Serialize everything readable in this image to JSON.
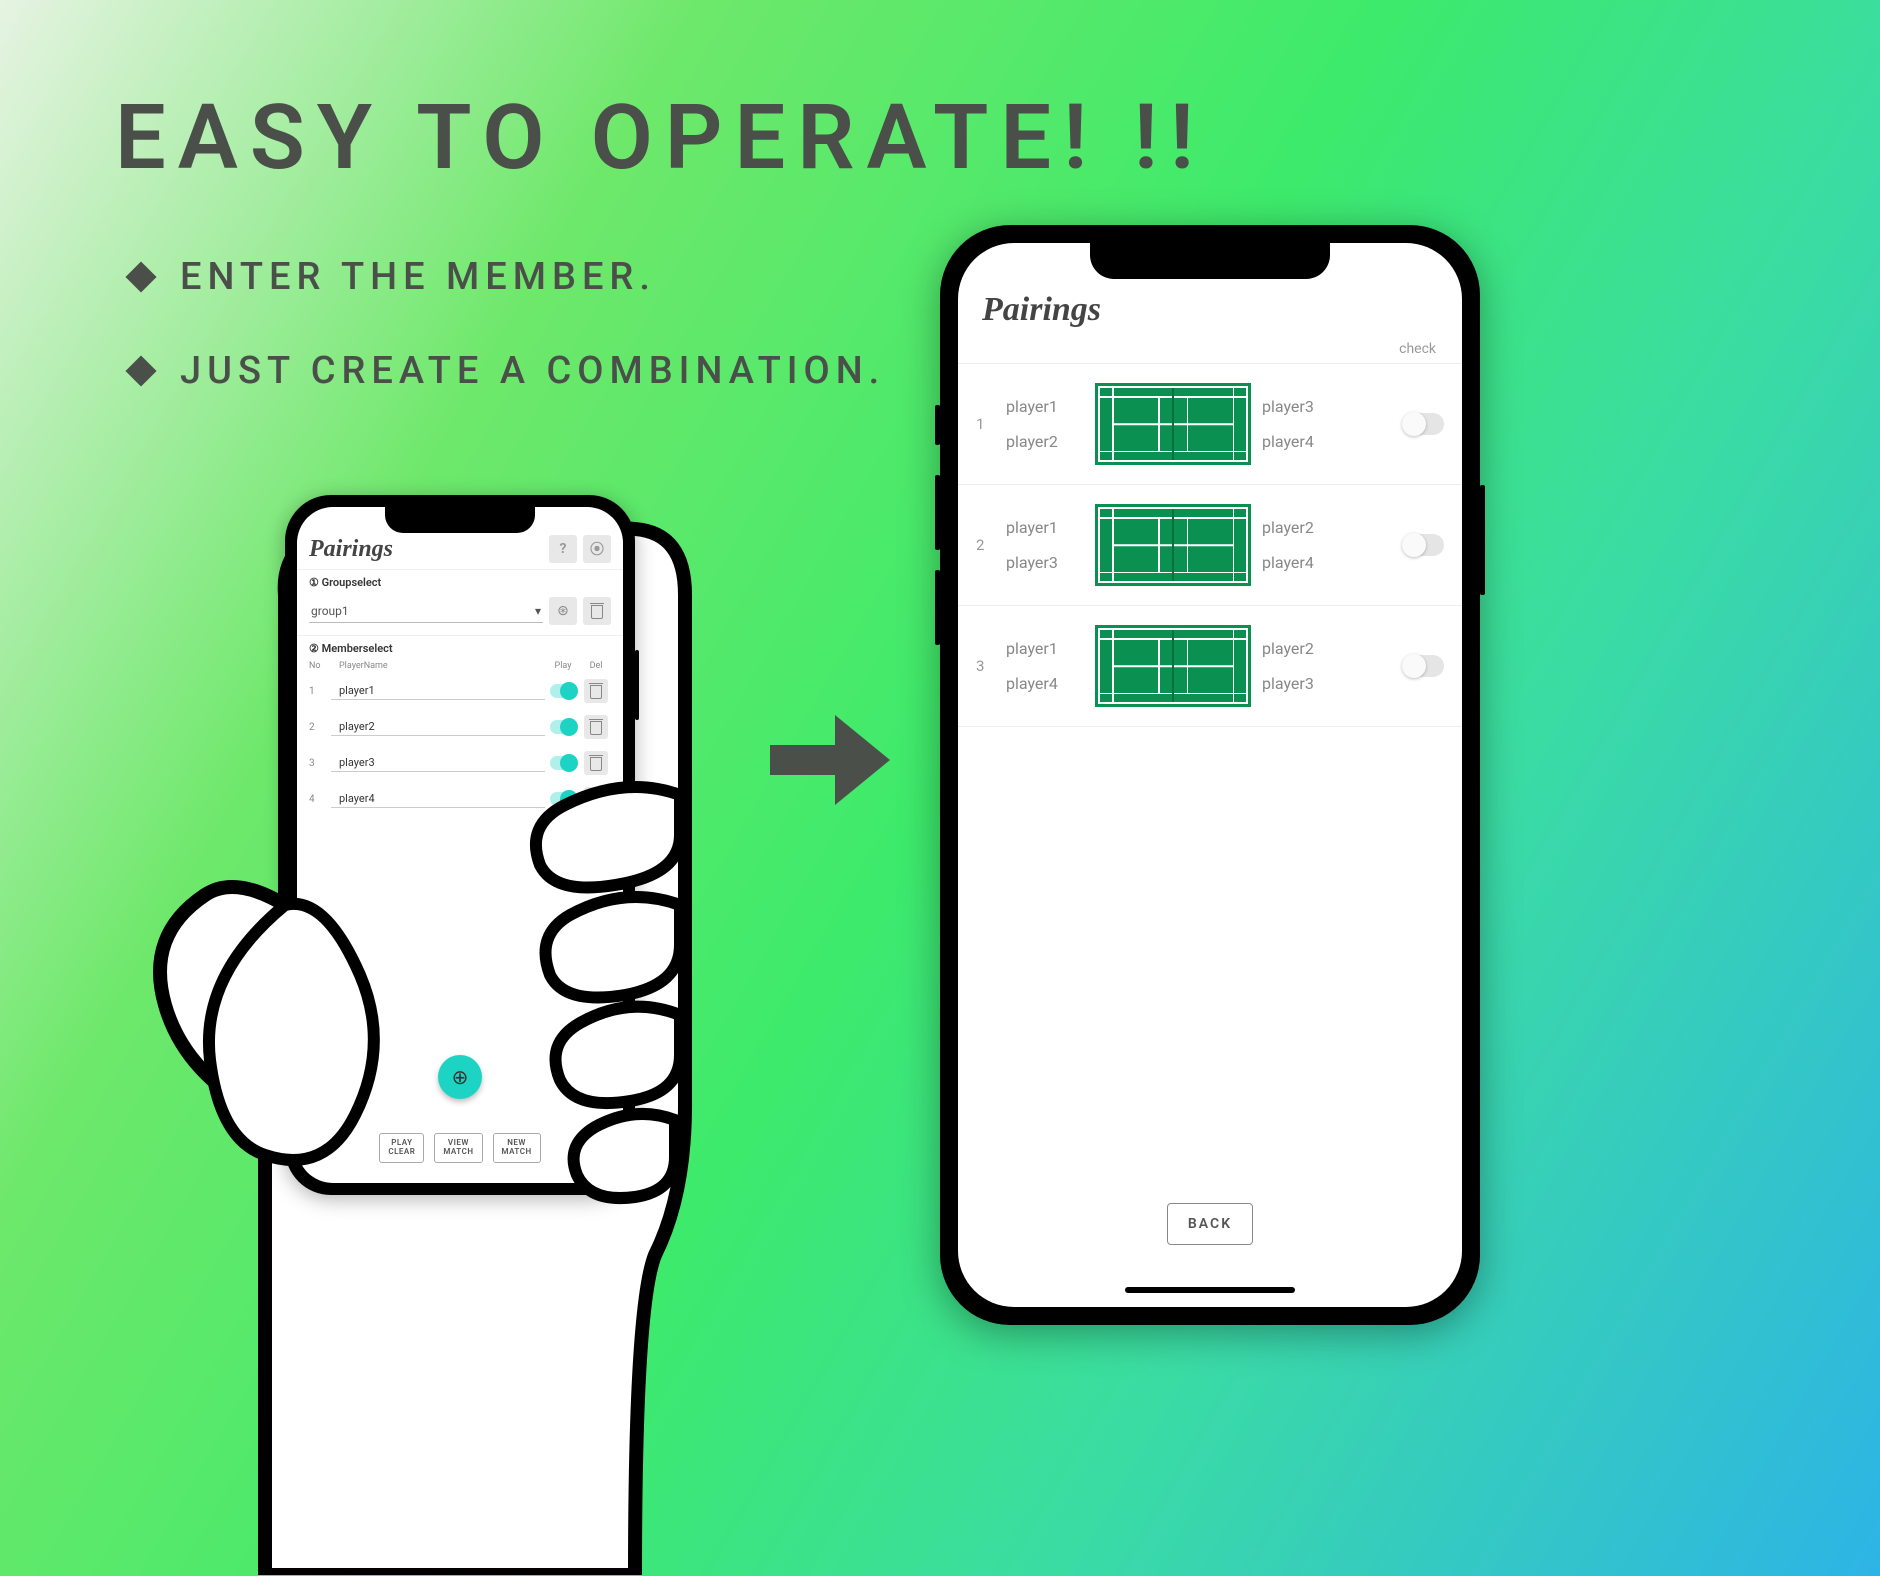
{
  "headline": "EASY TO OPERATE! !!",
  "bullets": [
    "ENTER THE MEMBER.",
    "JUST CREATE A COMBINATION."
  ],
  "left_app": {
    "title": "Pairings",
    "section_group_label": "① Groupselect",
    "group_selected": "group1",
    "section_member_label": "② Memberselect",
    "columns": {
      "no": "No",
      "name": "PlayerName",
      "play": "Play",
      "del": "Del"
    },
    "members": [
      {
        "no": "1",
        "name": "player1"
      },
      {
        "no": "2",
        "name": "player2"
      },
      {
        "no": "3",
        "name": "player3"
      },
      {
        "no": "4",
        "name": "player4"
      }
    ],
    "buttons": {
      "play_clear": "PLAY\nCLEAR",
      "view_match": "VIEW\nMATCH",
      "new_match": "NEW\nMATCH"
    }
  },
  "right_app": {
    "title": "Pairings",
    "check_label": "check",
    "matches": [
      {
        "no": "1",
        "left": [
          "player1",
          "player2"
        ],
        "right": [
          "player3",
          "player4"
        ]
      },
      {
        "no": "2",
        "left": [
          "player1",
          "player3"
        ],
        "right": [
          "player2",
          "player4"
        ]
      },
      {
        "no": "3",
        "left": [
          "player1",
          "player4"
        ],
        "right": [
          "player2",
          "player3"
        ]
      }
    ],
    "back_label": "BACK"
  }
}
